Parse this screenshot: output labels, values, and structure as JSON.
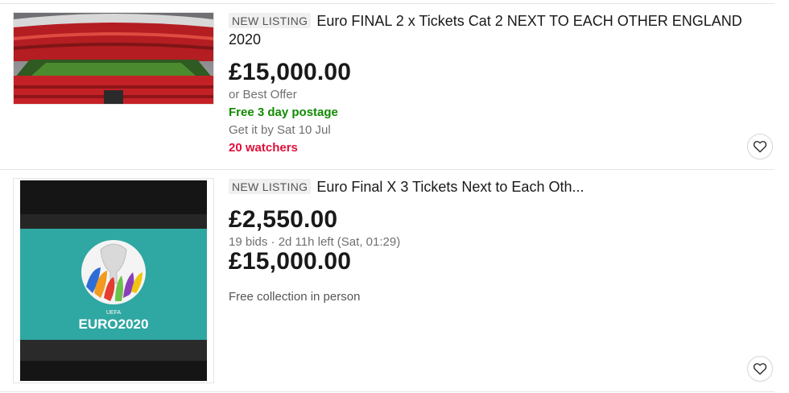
{
  "listings": [
    {
      "badge": "NEW LISTING",
      "title": "Euro FINAL 2 x Tickets Cat 2 NEXT TO EACH OTHER ENGLAND 2020",
      "price": "£15,000.00",
      "offer": "or Best Offer",
      "postage": "Free 3 day postage",
      "delivery": "Get it by Sat 10 Jul",
      "watchers": "20 watchers",
      "thumb_icon": "stadium-photo"
    },
    {
      "badge": "NEW LISTING",
      "title": "Euro Final X 3 Tickets Next to Each Oth...",
      "price": "£2,550.00",
      "bids": "19 bids · 2d 11h left (Sat, 01:29)",
      "buy_now_price": "£15,000.00",
      "collection": "Free collection in person",
      "thumb_icon": "euro2020-logo",
      "logo_text": "EURO2020",
      "logo_sub": "UEFA"
    }
  ],
  "colors": {
    "green": "#118a00",
    "red": "#e0103a",
    "teal": "#2fa7a2"
  },
  "icons": {
    "watch": "heart-icon"
  }
}
